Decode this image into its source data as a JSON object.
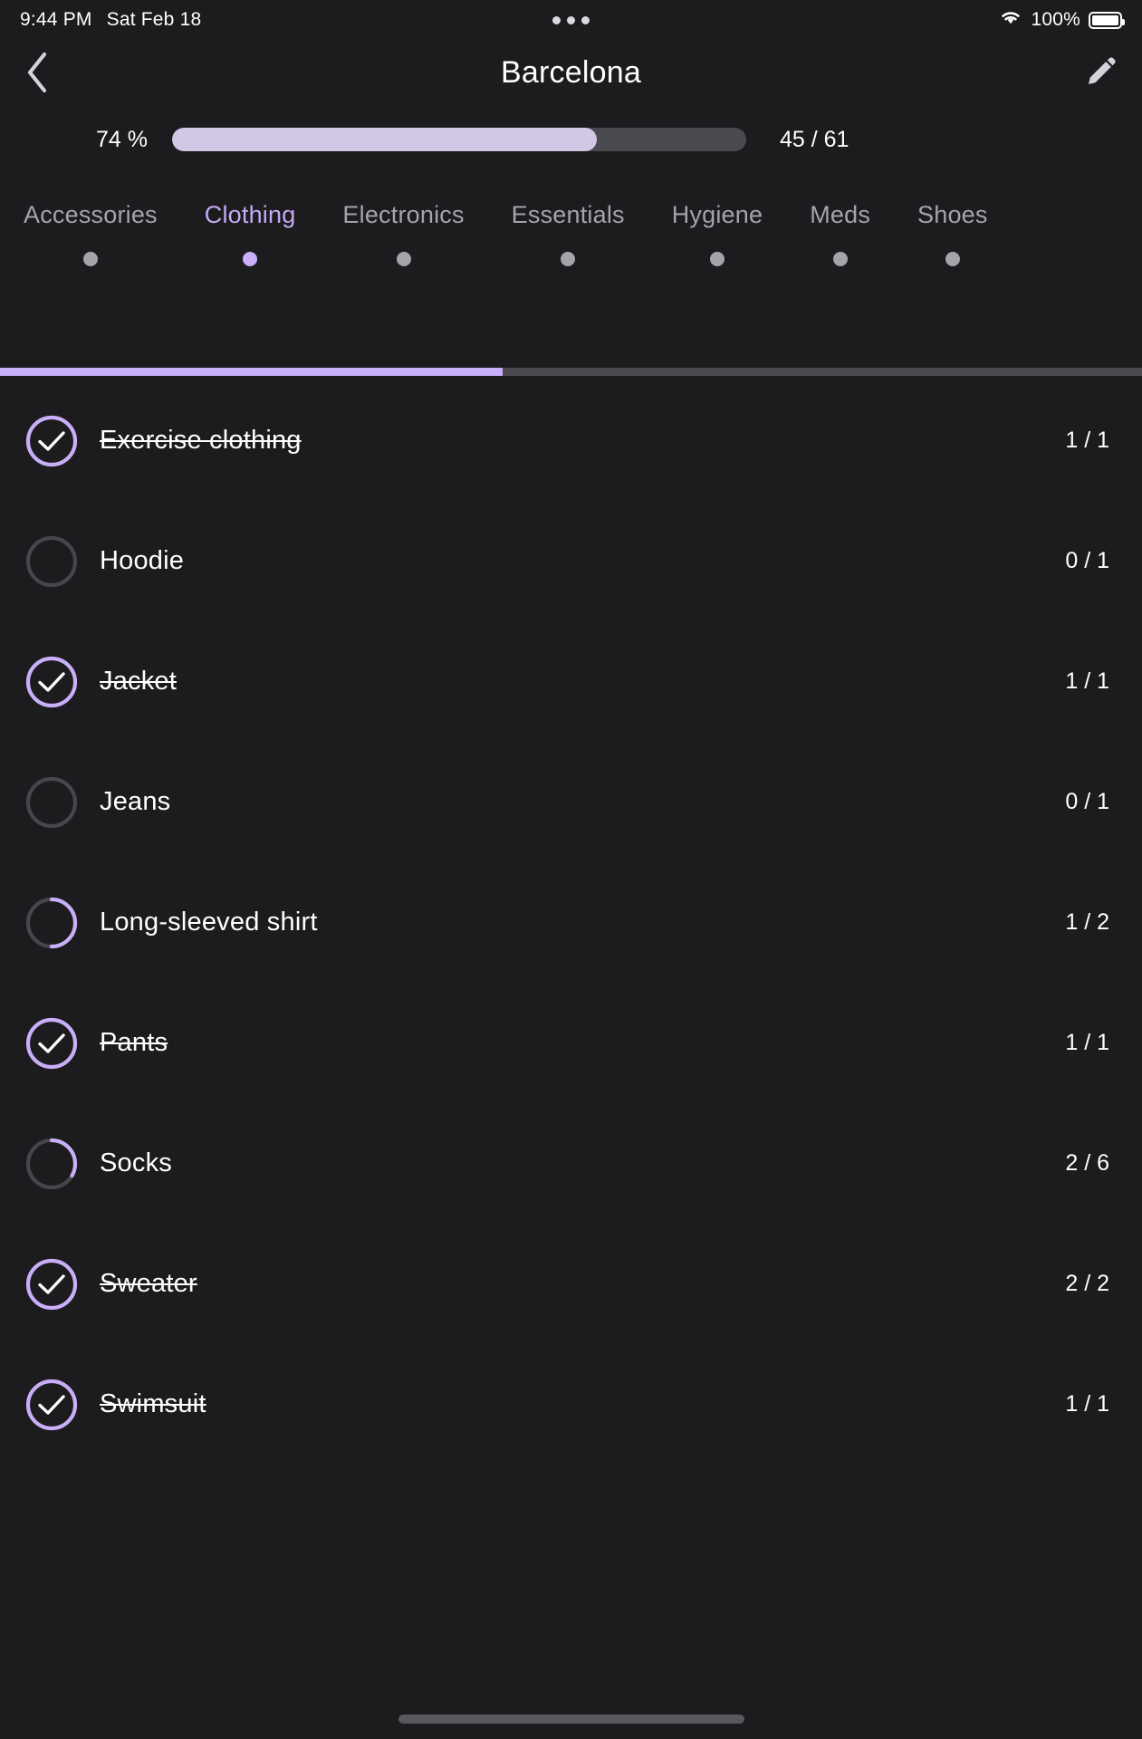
{
  "status_bar": {
    "time": "9:44 PM",
    "date": "Sat Feb 18",
    "battery_percent": "100%",
    "wifi_icon": "wifi-icon",
    "battery_icon": "battery-full-icon",
    "center_indicator": "three-dots-icon"
  },
  "nav": {
    "back_icon": "chevron-left-icon",
    "title": "Barcelona",
    "edit_icon": "pencil-icon"
  },
  "progress": {
    "percent_label": "74 %",
    "percent_value": 74,
    "count_label": "45 / 61",
    "packed": 45,
    "total": 61,
    "fill_color": "#d2c8e6",
    "track_color": "#4b4950"
  },
  "categories": {
    "active_index": 1,
    "items": [
      {
        "label": "Accessories"
      },
      {
        "label": "Clothing"
      },
      {
        "label": "Electronics"
      },
      {
        "label": "Essentials"
      },
      {
        "label": "Hygiene"
      },
      {
        "label": "Meds"
      },
      {
        "label": "Shoes"
      }
    ],
    "active_color": "#c5a9f5",
    "inactive_color": "#a6a3ab"
  },
  "scroll_indicator": {
    "thumb_percent": 44,
    "thumb_color": "#c9aef8",
    "track_color": "#4b4950"
  },
  "list": {
    "items": [
      {
        "label": "Exercise clothing",
        "count": "1 / 1",
        "done": 1,
        "total": 1,
        "state": "complete"
      },
      {
        "label": "Hoodie",
        "count": "0 / 1",
        "done": 0,
        "total": 1,
        "state": "empty"
      },
      {
        "label": "Jacket",
        "count": "1 / 1",
        "done": 1,
        "total": 1,
        "state": "complete"
      },
      {
        "label": "Jeans",
        "count": "0 / 1",
        "done": 0,
        "total": 1,
        "state": "empty"
      },
      {
        "label": "Long-sleeved shirt",
        "count": "1 / 2",
        "done": 1,
        "total": 2,
        "state": "partial"
      },
      {
        "label": "Pants",
        "count": "1 / 1",
        "done": 1,
        "total": 1,
        "state": "complete"
      },
      {
        "label": "Socks",
        "count": "2 / 6",
        "done": 2,
        "total": 6,
        "state": "partial"
      },
      {
        "label": "Sweater",
        "count": "2 / 2",
        "done": 2,
        "total": 2,
        "state": "complete"
      },
      {
        "label": "Swimsuit",
        "count": "1 / 1",
        "done": 1,
        "total": 1,
        "state": "complete"
      }
    ],
    "accent_color": "#c9aef8",
    "empty_ring_color": "#48464d",
    "check_icon": "check-icon"
  },
  "home_indicator": "home-indicator"
}
